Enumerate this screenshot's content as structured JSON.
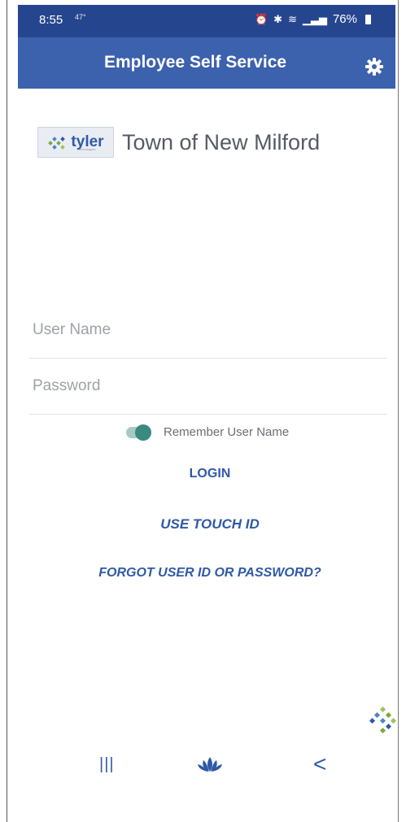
{
  "status_bar": {
    "time": "8:55",
    "small_indicator": "47°",
    "battery_percent": "76%"
  },
  "header": {
    "title": "Employee Self Service",
    "settings_icon": "gear-icon"
  },
  "brand": {
    "logo_text": "tyler",
    "logo_subtext": "technologies",
    "organization": "Town of New Milford"
  },
  "form": {
    "username_placeholder": "User Name",
    "password_placeholder": "Password",
    "remember_label": "Remember User Name",
    "remember_enabled": true
  },
  "actions": {
    "login": "LOGIN",
    "touch_id": "USE TOUCH ID",
    "forgot": "FORGOT USER ID OR PASSWORD?"
  },
  "nav": {
    "recent_glyph": "|||",
    "back_glyph": "<"
  },
  "colors": {
    "status_bar": "#25468f",
    "header": "#3c61ad",
    "accent": "#2f59a6",
    "toggle": "#3b8a7f"
  }
}
